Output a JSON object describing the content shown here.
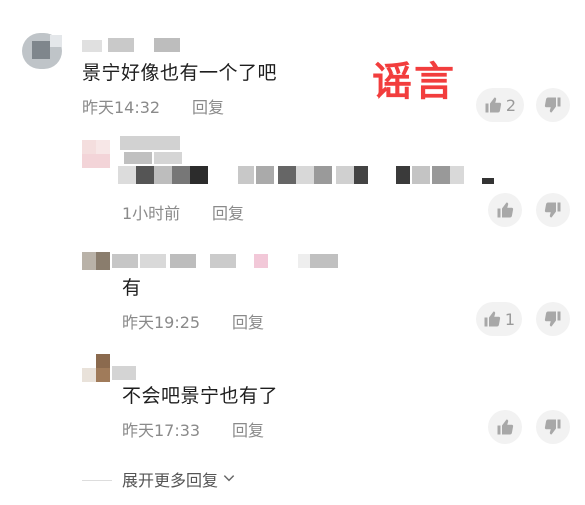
{
  "watermark": "谣言",
  "comment_main": {
    "text": "景宁好像也有一个了吧",
    "time": "昨天14:32",
    "reply_label": "回复",
    "like_count": "2"
  },
  "replies": [
    {
      "text": "",
      "time": "1小时前",
      "reply_label": "回复",
      "like_count": ""
    },
    {
      "text": "有",
      "time": "昨天19:25",
      "reply_label": "回复",
      "like_count": "1"
    },
    {
      "text": "不会吧景宁也有了",
      "time": "昨天17:33",
      "reply_label": "回复",
      "like_count": ""
    }
  ],
  "expand_label": "展开更多回复",
  "icons": [
    "thumb-up-icon",
    "thumb-down-icon",
    "chevron-down-icon"
  ]
}
